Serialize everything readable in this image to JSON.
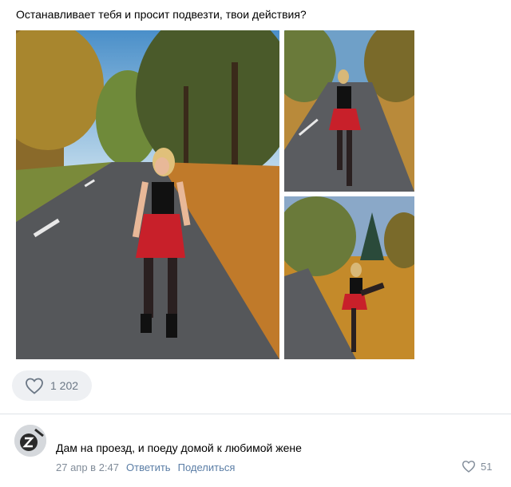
{
  "post": {
    "text": "Останавливает тебя и просит подвезти, твои действия?"
  },
  "likes": {
    "icon": "heart-outline-icon",
    "count": "1 202"
  },
  "comment": {
    "avatar_icon": "user-avatar",
    "text": "Дам на проезд, и поеду домой к любимой жене",
    "date": "27 апр в 2:47",
    "reply_label": "Ответить",
    "share_label": "Поделиться",
    "like_count": "51"
  },
  "colors": {
    "link": "#5b7ea6",
    "muted": "#818c99",
    "like_bg": "#eef0f3"
  }
}
